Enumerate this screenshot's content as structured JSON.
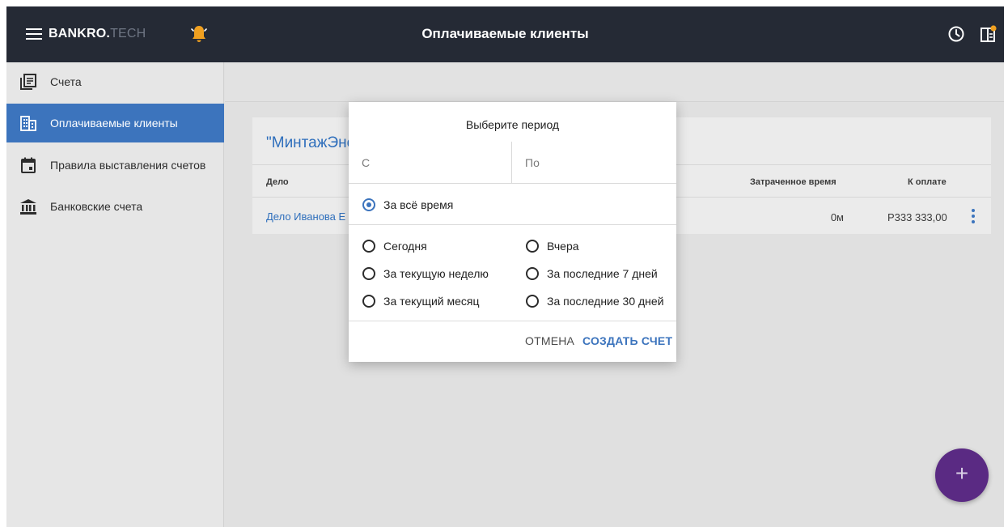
{
  "app": {
    "logo_main": "BANKRO.",
    "logo_suffix": "TECH",
    "title": "Оплачиваемые клиенты",
    "icons": [
      "menu-icon",
      "bell-icon",
      "clock-icon",
      "side-panel-icon"
    ]
  },
  "sidebar": {
    "items": [
      {
        "label": "Счета",
        "icon": "invoices-icon",
        "active": false
      },
      {
        "label": "Оплачиваемые клиенты",
        "icon": "building-icon",
        "active": true
      },
      {
        "label": "Правила выставления счетов",
        "icon": "calendar-icon",
        "active": false
      },
      {
        "label": "Банковские счета",
        "icon": "bank-icon",
        "active": false
      }
    ]
  },
  "card": {
    "title": "\"МинтажЭне",
    "columns": {
      "case": "Дело",
      "time_spent": "Затраченное время",
      "to_pay": "К оплате"
    },
    "rows": [
      {
        "case": "Дело Иванова Е",
        "time_spent": "0м",
        "to_pay": "Р333 333,00"
      }
    ]
  },
  "dialog": {
    "title": "Выберите период",
    "from_placeholder": "С",
    "to_placeholder": "По",
    "all_time": "За всё время",
    "options_left": [
      "Сегодня",
      "За текущую неделю",
      "За текущий месяц"
    ],
    "options_right": [
      "Вчера",
      "За последние 7 дней",
      "За последние 30 дней"
    ],
    "selected": "За всё время",
    "cancel_label": "ОТМЕНА",
    "create_label": "СОЗДАТЬ СЧЕТ"
  },
  "fab": {
    "label": "+"
  },
  "colors": {
    "topbar": "#252a35",
    "accent_blue": "#3c74bd",
    "bell_orange": "#f0a020",
    "fab_purple": "#5a2a83",
    "overlay_gray": "#e0e0e0"
  }
}
